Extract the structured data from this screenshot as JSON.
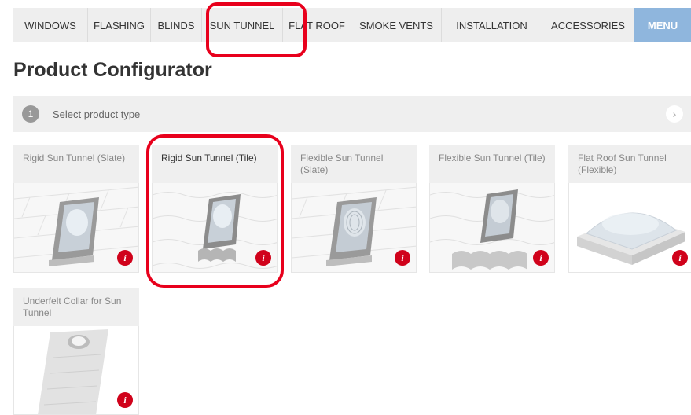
{
  "nav": {
    "items": [
      {
        "label": "WINDOWS"
      },
      {
        "label": "FLASHING"
      },
      {
        "label": "BLINDS"
      },
      {
        "label": "SUN TUNNEL"
      },
      {
        "label": "FLAT ROOF"
      },
      {
        "label": "SMOKE VENTS"
      },
      {
        "label": "INSTALLATION"
      },
      {
        "label": "ACCESSORIES"
      },
      {
        "label": "Menu"
      }
    ]
  },
  "page": {
    "title": "Product Configurator"
  },
  "step": {
    "number": "1",
    "label": "Select product type",
    "next_icon": "chevron-right-icon"
  },
  "products": [
    {
      "name": "Rigid Sun Tunnel (Slate)",
      "selected": false,
      "info_icon": "info-icon"
    },
    {
      "name": "Rigid Sun Tunnel (Tile)",
      "selected": true,
      "info_icon": "info-icon"
    },
    {
      "name": "Flexible Sun Tunnel (Slate)",
      "selected": false,
      "info_icon": "info-icon"
    },
    {
      "name": "Flexible Sun Tunnel (Tile)",
      "selected": false,
      "info_icon": "info-icon"
    },
    {
      "name": "Flat Roof Sun Tunnel (Flexible)",
      "selected": false,
      "info_icon": "info-icon"
    },
    {
      "name": "Underfelt Collar for Sun Tunnel",
      "selected": false,
      "info_icon": "info-icon"
    }
  ],
  "colors": {
    "accent_menu": "#8fb6dd",
    "highlight": "#e8001c",
    "info": "#d0021b"
  }
}
